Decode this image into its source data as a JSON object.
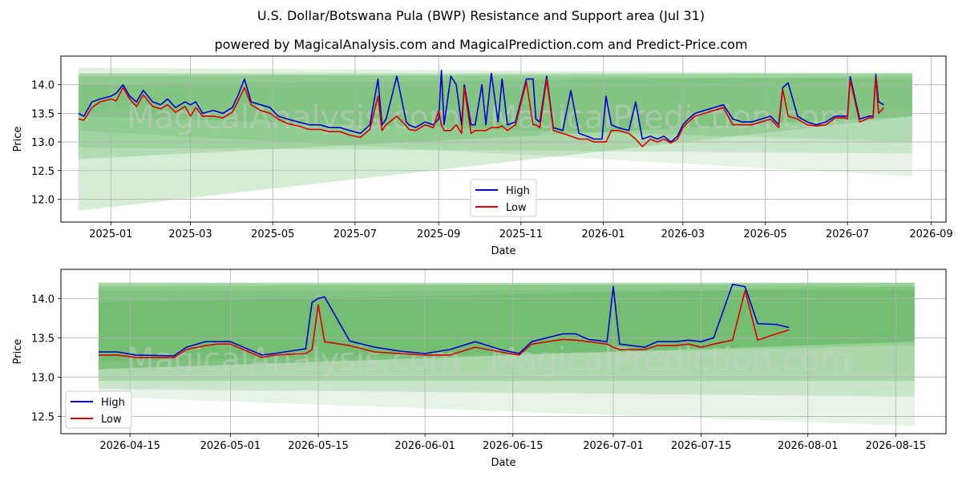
{
  "title": "U.S. Dollar/Botswana Pula (BWP) Resistance and Support area (Jul 31)",
  "subtitle": "powered by MagicalAnalysis.com and MagicalPrediction.com and Predict-Price.com",
  "watermarks": [
    "MagicalAnalysis.com",
    "MagicalPrediction.com"
  ],
  "colors": {
    "high": "#0000cc",
    "low": "#dd0000",
    "band": "#2e9e2e",
    "grid": "#b0b0b0"
  },
  "chart_data": [
    {
      "type": "line",
      "xlabel": "Date",
      "ylabel": "Price",
      "xlim": [
        "2024-11-25",
        "2026-09-12"
      ],
      "ylim": [
        11.6,
        14.5
      ],
      "x_ticks": [
        "2025-01",
        "2025-03",
        "2025-05",
        "2025-07",
        "2025-09",
        "2025-11",
        "2026-01",
        "2026-03",
        "2026-05",
        "2026-07",
        "2026-09"
      ],
      "y_ticks": [
        "12.0",
        "12.5",
        "13.0",
        "13.5",
        "14.0"
      ],
      "legend": {
        "position": "lower-center",
        "entries": [
          "High",
          "Low"
        ]
      },
      "grid": true,
      "bands": [
        {
          "x": [
            "2024-12-08",
            "2026-08-18"
          ],
          "top": [
            14.2,
            14.2
          ],
          "bottom": [
            11.8,
            13.45
          ],
          "opacity": 0.2
        },
        {
          "x": [
            "2024-12-08",
            "2026-08-18"
          ],
          "top": [
            14.15,
            14.2
          ],
          "bottom": [
            12.7,
            13.45
          ],
          "opacity": 0.2
        },
        {
          "x": [
            "2024-12-08",
            "2026-08-18"
          ],
          "top": [
            14.3,
            14.2
          ],
          "bottom": [
            12.9,
            12.8
          ],
          "opacity": 0.15
        },
        {
          "x": [
            "2024-12-08",
            "2026-08-18"
          ],
          "top": [
            14.2,
            14.1
          ],
          "bottom": [
            13.2,
            12.4
          ],
          "opacity": 0.12
        },
        {
          "x": [
            "2024-12-08",
            "2026-08-18"
          ],
          "top": [
            14.0,
            14.15
          ],
          "bottom": [
            13.45,
            13.0
          ],
          "opacity": 0.15
        }
      ],
      "series": [
        {
          "name": "High",
          "x": [
            "2024-12-08",
            "2024-12-12",
            "2024-12-18",
            "2024-12-24",
            "2025-01-01",
            "2025-01-05",
            "2025-01-10",
            "2025-01-15",
            "2025-01-20",
            "2025-01-25",
            "2025-02-01",
            "2025-02-07",
            "2025-02-12",
            "2025-02-18",
            "2025-02-25",
            "2025-03-01",
            "2025-03-05",
            "2025-03-10",
            "2025-03-18",
            "2025-03-25",
            "2025-04-01",
            "2025-04-05",
            "2025-04-10",
            "2025-04-15",
            "2025-04-22",
            "2025-04-29",
            "2025-05-05",
            "2025-05-12",
            "2025-05-20",
            "2025-05-28",
            "2025-06-05",
            "2025-06-12",
            "2025-06-20",
            "2025-06-27",
            "2025-07-05",
            "2025-07-12",
            "2025-07-18",
            "2025-07-21",
            "2025-07-24",
            "2025-08-01",
            "2025-08-08",
            "2025-08-10",
            "2025-08-15",
            "2025-08-22",
            "2025-08-28",
            "2025-09-01",
            "2025-09-03",
            "2025-09-05",
            "2025-09-10",
            "2025-09-14",
            "2025-09-18",
            "2025-09-20",
            "2025-09-25",
            "2025-09-28",
            "2025-10-03",
            "2025-10-06",
            "2025-10-10",
            "2025-10-15",
            "2025-10-18",
            "2025-10-22",
            "2025-10-28",
            "2025-11-05",
            "2025-11-10",
            "2025-11-12",
            "2025-11-15",
            "2025-11-20",
            "2025-11-25",
            "2025-12-02",
            "2025-12-08",
            "2025-12-14",
            "2025-12-20",
            "2025-12-25",
            "2025-12-31",
            "2026-01-03",
            "2026-01-07",
            "2026-01-12",
            "2026-01-20",
            "2026-01-25",
            "2026-01-30",
            "2026-02-05",
            "2026-02-10",
            "2026-02-15",
            "2026-02-20",
            "2026-02-25",
            "2026-03-01",
            "2026-03-05",
            "2026-03-10",
            "2026-03-17",
            "2026-03-24",
            "2026-03-31",
            "2026-04-07",
            "2026-04-14",
            "2026-04-21",
            "2026-04-28",
            "2026-05-05",
            "2026-05-11",
            "2026-05-14",
            "2026-05-18",
            "2026-05-25",
            "2026-06-01",
            "2026-06-08",
            "2026-06-15",
            "2026-06-22",
            "2026-06-29",
            "2026-07-01",
            "2026-07-03",
            "2026-07-10",
            "2026-07-17",
            "2026-07-20",
            "2026-07-22",
            "2026-07-24",
            "2026-07-28"
          ],
          "values": [
            13.5,
            13.45,
            13.7,
            13.75,
            13.8,
            13.85,
            14.0,
            13.8,
            13.7,
            13.9,
            13.7,
            13.65,
            13.75,
            13.6,
            13.7,
            13.65,
            13.7,
            13.5,
            13.55,
            13.5,
            13.6,
            13.8,
            14.1,
            13.7,
            13.65,
            13.6,
            13.45,
            13.4,
            13.35,
            13.3,
            13.3,
            13.25,
            13.25,
            13.2,
            13.15,
            13.3,
            14.1,
            13.3,
            13.4,
            14.15,
            13.35,
            13.3,
            13.25,
            13.35,
            13.3,
            13.4,
            14.25,
            13.3,
            14.15,
            14.0,
            13.3,
            14.0,
            13.3,
            13.3,
            14.0,
            13.3,
            14.2,
            13.35,
            14.1,
            13.3,
            13.35,
            14.1,
            14.1,
            13.4,
            13.35,
            14.15,
            13.25,
            13.2,
            13.9,
            13.15,
            13.1,
            13.05,
            13.05,
            13.8,
            13.3,
            13.25,
            13.2,
            13.7,
            13.05,
            13.1,
            13.05,
            13.1,
            13.0,
            13.1,
            13.3,
            13.4,
            13.5,
            13.55,
            13.6,
            13.65,
            13.4,
            13.35,
            13.35,
            13.4,
            13.45,
            13.3,
            13.95,
            14.03,
            13.45,
            13.35,
            13.3,
            13.35,
            13.45,
            13.45,
            13.45,
            14.14,
            13.4,
            13.45,
            13.45,
            14.18,
            13.7,
            13.65
          ]
        },
        {
          "name": "Low",
          "x": [
            "2024-12-08",
            "2024-12-12",
            "2024-12-18",
            "2024-12-24",
            "2025-01-01",
            "2025-01-05",
            "2025-01-10",
            "2025-01-15",
            "2025-01-20",
            "2025-01-25",
            "2025-02-01",
            "2025-02-07",
            "2025-02-12",
            "2025-02-18",
            "2025-02-25",
            "2025-03-01",
            "2025-03-05",
            "2025-03-10",
            "2025-03-18",
            "2025-03-25",
            "2025-04-01",
            "2025-04-05",
            "2025-04-10",
            "2025-04-15",
            "2025-04-22",
            "2025-04-29",
            "2025-05-05",
            "2025-05-12",
            "2025-05-20",
            "2025-05-28",
            "2025-06-05",
            "2025-06-12",
            "2025-06-20",
            "2025-06-27",
            "2025-07-05",
            "2025-07-12",
            "2025-07-18",
            "2025-07-21",
            "2025-07-24",
            "2025-08-01",
            "2025-08-08",
            "2025-08-10",
            "2025-08-15",
            "2025-08-22",
            "2025-08-28",
            "2025-09-01",
            "2025-09-03",
            "2025-09-05",
            "2025-09-10",
            "2025-09-14",
            "2025-09-18",
            "2025-09-20",
            "2025-09-25",
            "2025-09-28",
            "2025-10-03",
            "2025-10-06",
            "2025-10-10",
            "2025-10-15",
            "2025-10-18",
            "2025-10-22",
            "2025-10-28",
            "2025-11-05",
            "2025-11-10",
            "2025-11-12",
            "2025-11-15",
            "2025-11-20",
            "2025-11-25",
            "2025-12-02",
            "2025-12-08",
            "2025-12-14",
            "2025-12-20",
            "2025-12-25",
            "2025-12-31",
            "2026-01-03",
            "2026-01-07",
            "2026-01-12",
            "2026-01-20",
            "2026-01-25",
            "2026-01-30",
            "2026-02-05",
            "2026-02-10",
            "2026-02-15",
            "2026-02-20",
            "2026-02-25",
            "2026-03-01",
            "2026-03-05",
            "2026-03-10",
            "2026-03-17",
            "2026-03-24",
            "2026-03-31",
            "2026-04-07",
            "2026-04-14",
            "2026-04-21",
            "2026-04-28",
            "2026-05-05",
            "2026-05-11",
            "2026-05-14",
            "2026-05-18",
            "2026-05-25",
            "2026-06-01",
            "2026-06-08",
            "2026-06-15",
            "2026-06-22",
            "2026-06-29",
            "2026-07-01",
            "2026-07-03",
            "2026-07-10",
            "2026-07-17",
            "2026-07-20",
            "2026-07-22",
            "2026-07-24",
            "2026-07-28"
          ],
          "values": [
            13.4,
            13.38,
            13.6,
            13.7,
            13.75,
            13.72,
            13.95,
            13.75,
            13.62,
            13.82,
            13.62,
            13.58,
            13.65,
            13.52,
            13.62,
            13.45,
            13.6,
            13.45,
            13.45,
            13.42,
            13.52,
            13.7,
            13.95,
            13.65,
            13.55,
            13.5,
            13.4,
            13.32,
            13.28,
            13.22,
            13.22,
            13.18,
            13.18,
            13.12,
            13.08,
            13.22,
            13.8,
            13.2,
            13.3,
            13.45,
            13.28,
            13.22,
            13.2,
            13.3,
            13.25,
            13.55,
            13.3,
            13.2,
            13.2,
            13.3,
            13.15,
            13.95,
            13.15,
            13.2,
            13.2,
            13.2,
            13.25,
            13.25,
            13.28,
            13.2,
            13.3,
            14.05,
            13.3,
            13.3,
            13.25,
            14.1,
            13.2,
            13.15,
            13.1,
            13.05,
            13.05,
            13.0,
            13.0,
            13.0,
            13.2,
            13.2,
            13.15,
            13.05,
            12.92,
            13.05,
            13.0,
            13.05,
            12.98,
            13.05,
            13.25,
            13.35,
            13.45,
            13.5,
            13.55,
            13.6,
            13.3,
            13.3,
            13.3,
            13.35,
            13.4,
            13.25,
            13.92,
            13.45,
            13.4,
            13.3,
            13.28,
            13.3,
            13.42,
            13.42,
            13.4,
            14.08,
            13.35,
            13.42,
            13.42,
            14.12,
            13.5,
            13.6
          ]
        }
      ]
    },
    {
      "type": "line",
      "xlabel": "Date",
      "ylabel": "Price",
      "xlim": [
        "2026-04-04",
        "2026-08-23"
      ],
      "ylim": [
        12.28,
        14.37
      ],
      "x_ticks": [
        "2026-04-15",
        "2026-05-01",
        "2026-05-15",
        "2026-06-01",
        "2026-06-15",
        "2026-07-01",
        "2026-07-15",
        "2026-08-01",
        "2026-08-15"
      ],
      "y_ticks": [
        "12.5",
        "13.0",
        "13.5",
        "14.0"
      ],
      "legend": {
        "position": "lower-left",
        "entries": [
          "High",
          "Low"
        ]
      },
      "grid": true,
      "bands": [
        {
          "x": [
            "2026-04-10",
            "2026-08-18"
          ],
          "top": [
            14.2,
            14.2
          ],
          "bottom": [
            13.1,
            13.45
          ],
          "opacity": 0.35
        },
        {
          "x": [
            "2026-04-10",
            "2026-08-18"
          ],
          "top": [
            14.15,
            14.2
          ],
          "bottom": [
            12.95,
            12.95
          ],
          "opacity": 0.2
        },
        {
          "x": [
            "2026-04-10",
            "2026-08-18"
          ],
          "top": [
            14.2,
            14.15
          ],
          "bottom": [
            12.85,
            12.75
          ],
          "opacity": 0.15
        },
        {
          "x": [
            "2026-04-10",
            "2026-08-18"
          ],
          "top": [
            14.1,
            14.1
          ],
          "bottom": [
            12.75,
            12.38
          ],
          "opacity": 0.12
        },
        {
          "x": [
            "2026-04-10",
            "2026-08-18"
          ],
          "top": [
            13.95,
            14.15
          ],
          "bottom": [
            13.2,
            13.4
          ],
          "opacity": 0.15
        }
      ],
      "series": [
        {
          "name": "High",
          "x": [
            "2026-04-10",
            "2026-04-13",
            "2026-04-16",
            "2026-04-22",
            "2026-04-24",
            "2026-04-27",
            "2026-04-29",
            "2026-05-01",
            "2026-05-06",
            "2026-05-08",
            "2026-05-13",
            "2026-05-14",
            "2026-05-15",
            "2026-05-16",
            "2026-05-20",
            "2026-05-24",
            "2026-05-28",
            "2026-06-01",
            "2026-06-05",
            "2026-06-09",
            "2026-06-13",
            "2026-06-16",
            "2026-06-18",
            "2026-06-23",
            "2026-06-25",
            "2026-06-27",
            "2026-06-30",
            "2026-07-01",
            "2026-07-02",
            "2026-07-06",
            "2026-07-08",
            "2026-07-11",
            "2026-07-13",
            "2026-07-15",
            "2026-07-17",
            "2026-07-20",
            "2026-07-22",
            "2026-07-24",
            "2026-07-27",
            "2026-07-29"
          ],
          "values": [
            13.32,
            13.32,
            13.28,
            13.27,
            13.38,
            13.45,
            13.45,
            13.45,
            13.28,
            13.3,
            13.36,
            13.95,
            14.0,
            14.02,
            13.46,
            13.38,
            13.33,
            13.3,
            13.35,
            13.45,
            13.35,
            13.3,
            13.45,
            13.55,
            13.55,
            13.48,
            13.45,
            14.15,
            13.42,
            13.38,
            13.45,
            13.45,
            13.47,
            13.45,
            13.5,
            14.18,
            14.15,
            13.68,
            13.67,
            13.63
          ]
        },
        {
          "name": "Low",
          "x": [
            "2026-04-10",
            "2026-04-13",
            "2026-04-16",
            "2026-04-22",
            "2026-04-24",
            "2026-04-27",
            "2026-04-29",
            "2026-05-01",
            "2026-05-06",
            "2026-05-08",
            "2026-05-13",
            "2026-05-14",
            "2026-05-15",
            "2026-05-16",
            "2026-05-20",
            "2026-05-24",
            "2026-05-28",
            "2026-06-01",
            "2026-06-05",
            "2026-06-09",
            "2026-06-13",
            "2026-06-16",
            "2026-06-18",
            "2026-06-23",
            "2026-06-25",
            "2026-06-27",
            "2026-06-30",
            "2026-07-01",
            "2026-07-02",
            "2026-07-06",
            "2026-07-08",
            "2026-07-11",
            "2026-07-13",
            "2026-07-15",
            "2026-07-17",
            "2026-07-20",
            "2026-07-22",
            "2026-07-24",
            "2026-07-27",
            "2026-07-29"
          ],
          "values": [
            13.28,
            13.28,
            13.25,
            13.25,
            13.35,
            13.4,
            13.42,
            13.42,
            13.25,
            13.28,
            13.3,
            13.35,
            13.92,
            13.45,
            13.4,
            13.32,
            13.3,
            13.28,
            13.28,
            13.38,
            13.32,
            13.28,
            13.42,
            13.48,
            13.47,
            13.45,
            13.42,
            13.38,
            13.35,
            13.35,
            13.4,
            13.4,
            13.42,
            13.38,
            13.42,
            13.47,
            14.1,
            13.47,
            13.55,
            13.6
          ]
        }
      ]
    }
  ]
}
